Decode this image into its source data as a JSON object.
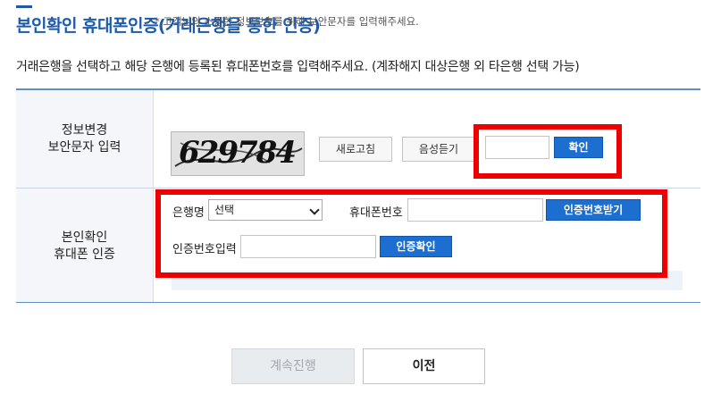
{
  "header": {
    "title": "본인확인 휴대폰인증(거래은행을 통한 인증)",
    "description": "거래은행을 선택하고 해당 은행에 등록된 휴대폰번호를 입력해주세요. (계좌해지 대상은행 외 타은행 선택 가능)"
  },
  "security": {
    "row_label_line1": "정보변경",
    "row_label_line2": "보안문자 입력",
    "note": "* 고객님의 소중한 정보보호를 위해 보안문자를 입력해주세요.",
    "captcha_text": "629784",
    "refresh_label": "새로고침",
    "audio_label": "음성듣기",
    "input_value": "",
    "confirm_label": "확인"
  },
  "phone_auth": {
    "row_label_line1": "본인확인",
    "row_label_line2": "휴대폰 인증",
    "bank_label": "은행명",
    "bank_selected": "선택",
    "phone_label": "휴대폰번호",
    "phone_value": "",
    "request_code_label": "인증번호받기",
    "code_label": "인증번호입력",
    "code_value": "",
    "verify_label": "인증확인"
  },
  "footer": {
    "continue_label": "계속진행",
    "previous_label": "이전"
  },
  "colors": {
    "accent": "#1e5aa8",
    "button_blue": "#1c6fd1",
    "highlight_red": "#ee0000"
  }
}
